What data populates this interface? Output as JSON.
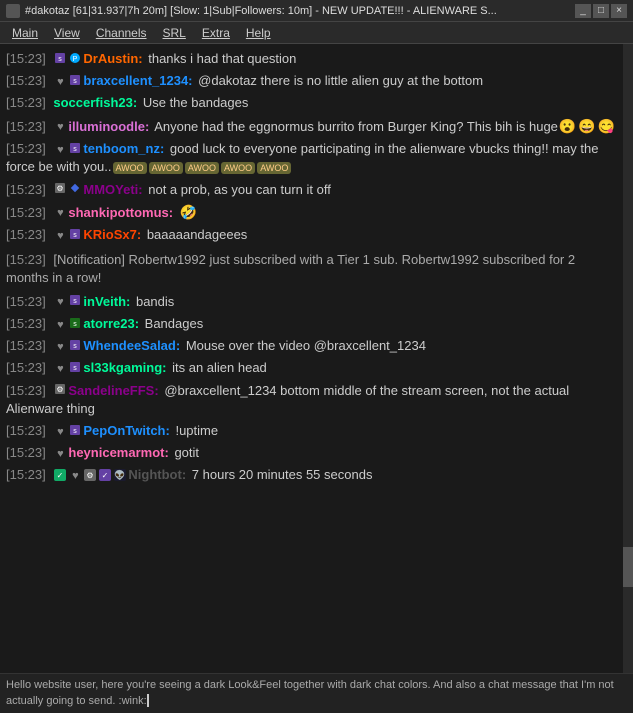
{
  "titleBar": {
    "title": "#dakotaz [61|31.937|7h 20m] [Slow: 1|Sub|Followers: 10m] - NEW UPDATE!!! - ALIENWARE S...",
    "minimize": "_",
    "maximize": "□",
    "close": "×"
  },
  "menuBar": {
    "items": [
      "View",
      "Channels",
      "SRL",
      "Extra",
      "Help"
    ],
    "first": "Main"
  },
  "messages": [
    {
      "id": 1,
      "timestamp": "[15:23]",
      "badges": [
        {
          "type": "sub",
          "label": "s"
        },
        {
          "type": "prime",
          "label": "P"
        }
      ],
      "username": "DrAustin:",
      "usernameColor": "#ff6600",
      "message": "thanks i had that question",
      "hasEmote": false
    },
    {
      "id": 2,
      "timestamp": "[15:23]",
      "badges": [
        {
          "type": "heart",
          "label": "♥"
        },
        {
          "type": "sub",
          "label": "s"
        }
      ],
      "username": "braxcellent_1234:",
      "usernameColor": "#1e90ff",
      "message": "@dakotaz there is no little alien guy at the bottom",
      "hasEmote": false
    },
    {
      "id": 3,
      "timestamp": "[15:23]",
      "badges": [],
      "username": "soccerfish23:",
      "usernameColor": "#00fa9a",
      "message": "Use the bandages",
      "hasEmote": false
    },
    {
      "id": 4,
      "timestamp": "[15:23]",
      "badges": [
        {
          "type": "heart",
          "label": "♥"
        }
      ],
      "username": "illuminoodle:",
      "usernameColor": "#da70d6",
      "message": "Anyone had the eggnormus burrito from Burger King? This bih is huge",
      "hasEmote": true,
      "emotes": [
        "😮",
        "😄",
        "😋"
      ]
    },
    {
      "id": 5,
      "timestamp": "[15:23]",
      "badges": [
        {
          "type": "heart",
          "label": "♥"
        },
        {
          "type": "sub",
          "label": "s"
        }
      ],
      "username": "tenboom_nz:",
      "usernameColor": "#1e90ff",
      "message": "good luck to everyone participating in the alienware vbucks thing!! may the force be with you..",
      "hasEmote": true,
      "emotes": [
        "AWOO",
        "AWOO",
        "AWOO",
        "AWOO",
        "AWOO"
      ]
    },
    {
      "id": 6,
      "timestamp": "[15:23]",
      "badges": [
        {
          "type": "gear",
          "label": "⚙"
        },
        {
          "type": "diamond",
          "label": "◆"
        }
      ],
      "username": "MMOYeti:",
      "usernameColor": "#8b008b",
      "message": "not a prob, as you can turn it off",
      "hasEmote": false
    },
    {
      "id": 7,
      "timestamp": "[15:23]",
      "badges": [
        {
          "type": "heart",
          "label": "♥"
        }
      ],
      "username": "shankipottomus:",
      "usernameColor": "#ff69b4",
      "message": "",
      "hasEmote": true,
      "emotes": [
        "🤣"
      ]
    },
    {
      "id": 8,
      "timestamp": "[15:23]",
      "badges": [
        {
          "type": "heart",
          "label": "♥"
        },
        {
          "type": "sub",
          "label": "s"
        }
      ],
      "username": "KRioSx7:",
      "usernameColor": "#ff4500",
      "message": "baaaaandageees",
      "hasEmote": false
    },
    {
      "id": 9,
      "timestamp": "[15:23]",
      "type": "notification",
      "message": "[Notification] Robertw1992 just subscribed with a Tier 1 sub. Robertw1992 subscribed for 2 months in a row!"
    },
    {
      "id": 10,
      "timestamp": "[15:23]",
      "badges": [
        {
          "type": "heart",
          "label": "♥"
        },
        {
          "type": "sub",
          "label": "s"
        }
      ],
      "username": "inVeith:",
      "usernameColor": "#00fa9a",
      "message": "bandis",
      "hasEmote": false
    },
    {
      "id": 11,
      "timestamp": "[15:23]",
      "badges": [
        {
          "type": "heart",
          "label": "♥"
        },
        {
          "type": "sub-green",
          "label": "s"
        }
      ],
      "username": "atorre23:",
      "usernameColor": "#00fa9a",
      "message": "Bandages",
      "hasEmote": false
    },
    {
      "id": 12,
      "timestamp": "[15:23]",
      "badges": [
        {
          "type": "heart",
          "label": "♥"
        },
        {
          "type": "sub",
          "label": "s"
        }
      ],
      "username": "WhendeeSalad:",
      "usernameColor": "#1e90ff",
      "message": "Mouse over the video @braxcellent_1234",
      "hasEmote": false
    },
    {
      "id": 13,
      "timestamp": "[15:23]",
      "badges": [
        {
          "type": "heart",
          "label": "♥"
        },
        {
          "type": "sub",
          "label": "s"
        }
      ],
      "username": "sl33kgaming:",
      "usernameColor": "#00fa9a",
      "message": "its an alien head",
      "hasEmote": false
    },
    {
      "id": 14,
      "timestamp": "[15:23]",
      "badges": [
        {
          "type": "gear",
          "label": "⚙"
        }
      ],
      "username": "SandelineFFS:",
      "usernameColor": "#8b008b",
      "message": "@braxcellent_1234 bottom middle of the stream screen, not the actual Alienware thing",
      "hasEmote": false
    },
    {
      "id": 15,
      "timestamp": "[15:23]",
      "badges": [
        {
          "type": "heart",
          "label": "♥"
        },
        {
          "type": "sub",
          "label": "s"
        }
      ],
      "username": "PepOnTwitch:",
      "usernameColor": "#1e90ff",
      "message": "!uptime",
      "hasEmote": false
    },
    {
      "id": 16,
      "timestamp": "[15:23]",
      "badges": [
        {
          "type": "heart",
          "label": "♥"
        }
      ],
      "username": "heynicemarmot:",
      "usernameColor": "#ff69b4",
      "message": "gotit",
      "hasEmote": false
    },
    {
      "id": 17,
      "timestamp": "[15:23]",
      "badges": [
        {
          "type": "nb-green",
          "label": "✔"
        },
        {
          "type": "nb-heart",
          "label": "♥"
        },
        {
          "type": "nb-gear",
          "label": "⚙"
        },
        {
          "type": "nb-check",
          "label": "✔"
        },
        {
          "type": "nb-alien",
          "label": "👽"
        }
      ],
      "username": "Nightbot:",
      "usernameColor": "#555",
      "message": "7 hours 20 minutes 55 seconds",
      "hasEmote": false,
      "isBot": true
    }
  ],
  "infoBar": {
    "text": "Hello website user, here you're seeing a dark Look&Feel together with dark chat colors. And also a chat message that I'm not actually going to send. :wink:"
  }
}
